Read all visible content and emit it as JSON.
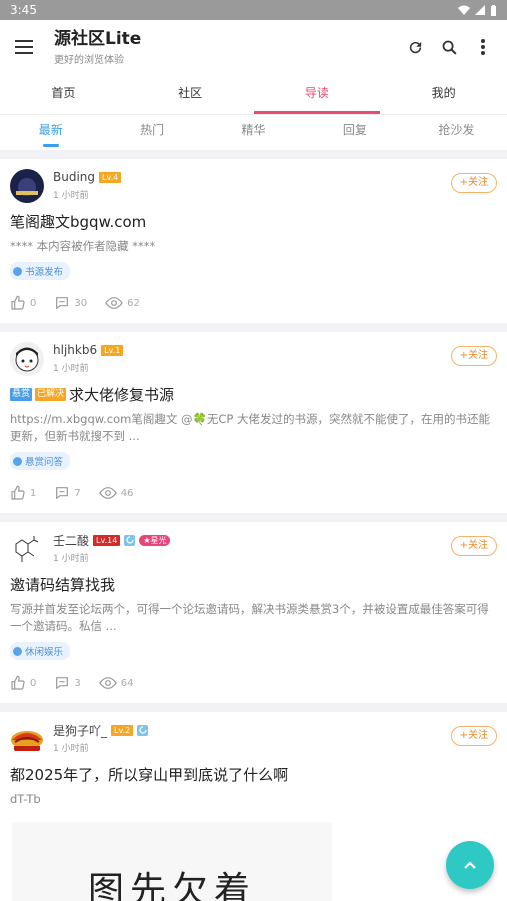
{
  "status": {
    "time": "3:45"
  },
  "app": {
    "title": "源社区Lite",
    "subtitle": "更好的浏览体验"
  },
  "main_tabs": [
    {
      "label": "首页"
    },
    {
      "label": "社区"
    },
    {
      "label": "导读",
      "active": true
    },
    {
      "label": "我的"
    }
  ],
  "sub_tabs": [
    {
      "label": "最新",
      "active": true
    },
    {
      "label": "热门"
    },
    {
      "label": "精华"
    },
    {
      "label": "回复"
    },
    {
      "label": "抢沙发"
    }
  ],
  "follow_label": "+关注",
  "posts": [
    {
      "username": "Buding",
      "level": "Lv.4",
      "time": "1 小时前",
      "title": "笔阁趣文bgqw.com",
      "excerpt": "**** 本内容被作者隐藏 ****",
      "category": "书源发布",
      "likes": "0",
      "comments": "30",
      "views": "62"
    },
    {
      "username": "hljhkb6",
      "level": "Lv.1",
      "time": "1 小时前",
      "tags": [
        "悬赏",
        "已解决"
      ],
      "title": "求大佬修复书源",
      "excerpt": "https://m.xbgqw.com笔阁趣文 @🍀无CP 大佬发过的书源，突然就不能使了，在用的书还能更新，但新书就搜不到 ...",
      "category": "悬赏问答",
      "likes": "1",
      "comments": "7",
      "views": "46"
    },
    {
      "username": "壬二酸",
      "level": "Lv.14",
      "badge": "★星光",
      "time": "1 小时前",
      "title": "邀请码结算找我",
      "excerpt": "写源并首发至论坛两个，可得一个论坛邀请码，解决书源类悬赏3个，并被设置成最佳答案可得一个邀请码。私信 ...",
      "category": "休闲娱乐",
      "likes": "0",
      "comments": "3",
      "views": "64"
    },
    {
      "username": "是狗子吖_",
      "level": "Lv.2",
      "time": "1 小时前",
      "title": "都2025年了，所以穿山甲到底说了什么啊",
      "excerpt": "dT-Tb",
      "image_text": "图先欠着"
    }
  ],
  "colors": {
    "accent_pink": "#e84c6c",
    "accent_blue": "#3a9eea",
    "fab": "#2ec9c5"
  }
}
